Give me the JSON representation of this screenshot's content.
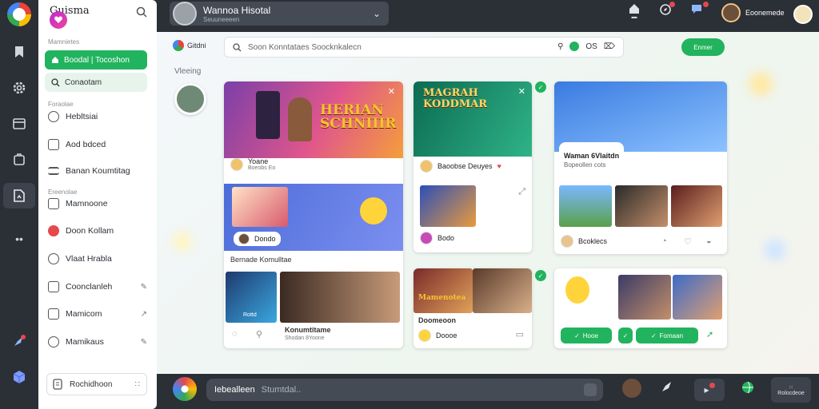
{
  "sidebar": {
    "brand": "Guisma",
    "section1": "Mamnietes",
    "primary_btn": "Boodal | Tocoshon",
    "secondary_btn": "Conaotam",
    "section2": "Foraolae",
    "items_a": [
      {
        "label": "Hebltsiai",
        "icon": "info-circle-icon"
      },
      {
        "label": "Aod bdced",
        "icon": "square-icon"
      },
      {
        "label": "Banan Koumtitag",
        "icon": "list-icon"
      }
    ],
    "section3": "Ereenolae",
    "items_b": [
      {
        "label": "Mamnoone",
        "icon": "checkbox-icon",
        "tail": ""
      },
      {
        "label": "Doon Kollam",
        "icon": "record-icon",
        "tail": ""
      },
      {
        "label": "Vlaat Hrabla",
        "icon": "chat-icon",
        "tail": ""
      },
      {
        "label": "Coonclanleh",
        "icon": "square-icon",
        "tail": "✎"
      },
      {
        "label": "Mamicom",
        "icon": "square-icon",
        "tail": "↗"
      },
      {
        "label": "Mamikaus",
        "icon": "circle-icon",
        "tail": "✎"
      }
    ],
    "footer": "Rochidhoon",
    "footer_tail": "∷"
  },
  "topbar": {
    "channel_title": "Wannoa Hisotal",
    "channel_sub": "Seuuneeeen",
    "user_name": "Eoonemede"
  },
  "main": {
    "logo_text": "Gitdni",
    "search_placeholder": "Soon Konntataes Soocknkalecn",
    "search_right": "OS",
    "action_btn": "Enmer",
    "viewing": "Vleeing"
  },
  "cards": {
    "c1": {
      "title": "HERIAN SCHNIIIR",
      "host": "Yoane",
      "sub": "Boeobs Eo",
      "section": "Bernade Komulltae",
      "badge": "Dondo",
      "vid_title": "Konumtitame",
      "vid_sub": "Shodan 8Yoone",
      "thumb_cap": "Rottd"
    },
    "c2": {
      "title": "MAGRAH KODDMAR",
      "ch_name": "Baoobse Deuyes",
      "ch2": "Bodo",
      "vid_title": "Doomeoon",
      "vid_sub": "Doooe",
      "thumb_cap": "Mamenotea"
    },
    "c3": {
      "title": "Waman 6Vlaitdn",
      "sub": "Bopeollen cots",
      "row": "Bcoklecs",
      "chip1": "Hooe",
      "chip2": "Fomaan"
    }
  },
  "composer": {
    "label": "Iebealleen",
    "placeholder": "Stumtdal..",
    "last_btn": "Rolocdeoe"
  },
  "colors": {
    "accent": "#22b35e",
    "dark": "#2b2f36",
    "notif": "#e5484d"
  }
}
